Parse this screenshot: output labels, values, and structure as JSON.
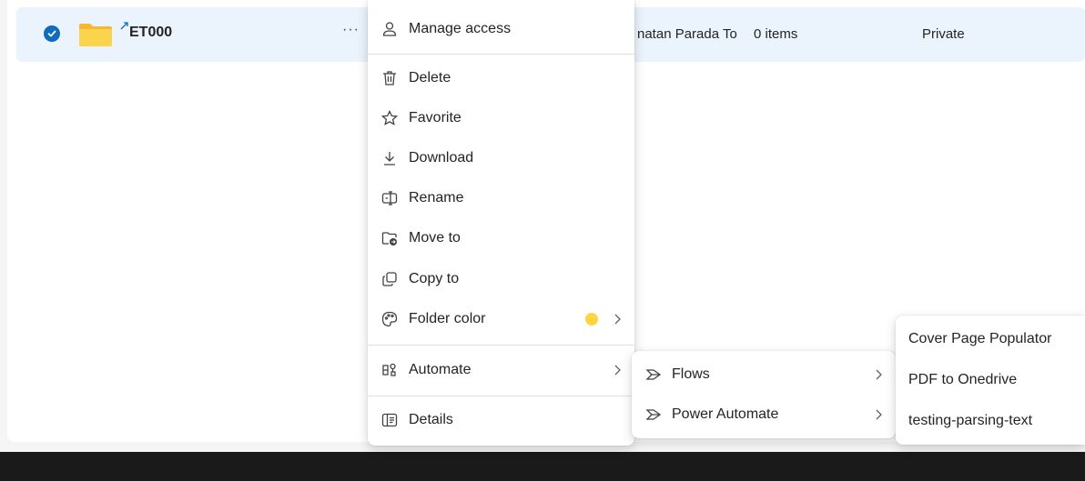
{
  "row": {
    "name": "ET000",
    "more": "···",
    "owner": "natan Parada To",
    "items": "0 items",
    "sharing": "Private"
  },
  "context_menu": {
    "items": [
      {
        "label": "Manage access",
        "icon": "person-icon"
      },
      {
        "label": "Delete",
        "icon": "trash-icon"
      },
      {
        "label": "Favorite",
        "icon": "star-icon"
      },
      {
        "label": "Download",
        "icon": "download-icon"
      },
      {
        "label": "Rename",
        "icon": "rename-icon"
      },
      {
        "label": "Move to",
        "icon": "move-folder-icon"
      },
      {
        "label": "Copy to",
        "icon": "copy-icon"
      },
      {
        "label": "Folder color",
        "icon": "palette-icon",
        "swatch": "#fcd53f"
      },
      {
        "label": "Automate",
        "icon": "automate-icon"
      },
      {
        "label": "Details",
        "icon": "details-icon"
      }
    ]
  },
  "automate_menu": {
    "items": [
      {
        "label": "Flows",
        "icon": "flow-icon"
      },
      {
        "label": "Power Automate",
        "icon": "flow-icon"
      }
    ]
  },
  "flows_menu": {
    "items": [
      {
        "label": "Cover Page Populator"
      },
      {
        "label": "PDF to Onedrive"
      },
      {
        "label": "testing-parsing-text"
      }
    ]
  },
  "colors": {
    "accent": "#0f6cbd",
    "selected_row": "#ebf3fc",
    "folder": "#fcc33a"
  }
}
